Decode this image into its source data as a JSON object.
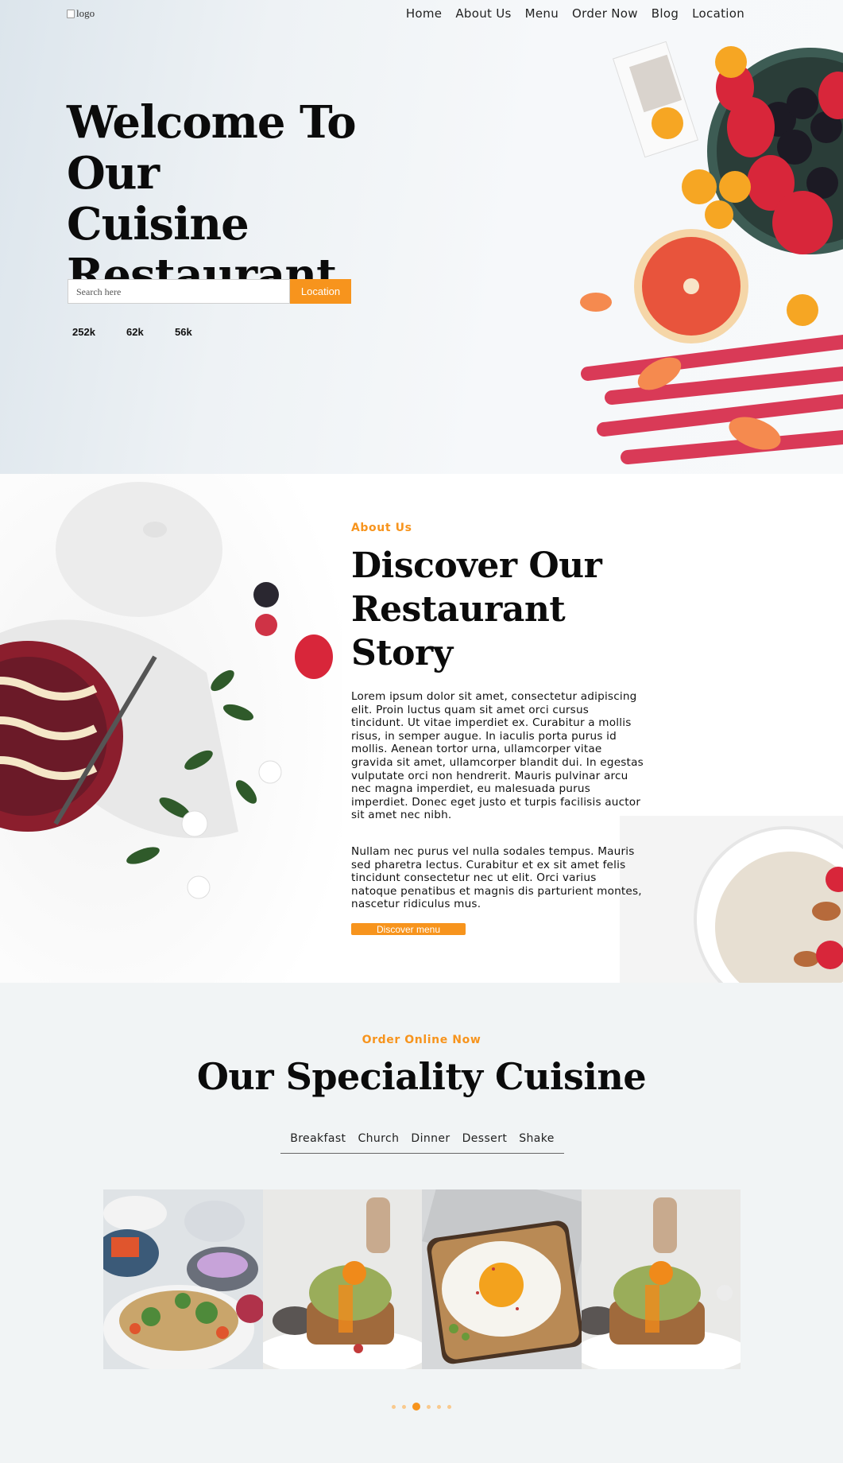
{
  "nav": {
    "logo_alt": "logo",
    "links": [
      "Home",
      "About Us",
      "Menu",
      "Order Now",
      "Blog",
      "Location"
    ]
  },
  "hero": {
    "title_lines": [
      "Welcome To Our",
      "Cuisine",
      "Restaurant"
    ],
    "search_placeholder": "Search here",
    "search_button": "Location",
    "stats": [
      "252k",
      "62k",
      "56k"
    ]
  },
  "about": {
    "kicker": "About Us",
    "title_lines": [
      "Discover Our",
      "Restaurant",
      "Story"
    ],
    "paragraph1": "Lorem ipsum dolor sit amet, consectetur adipiscing elit. Proin luctus quam sit amet orci cursus tincidunt. Ut vitae imperdiet ex. Curabitur a mollis risus, in semper augue. In iaculis porta purus id mollis. Aenean tortor urna, ullamcorper vitae gravida sit amet, ullamcorper blandit dui. In egestas vulputate orci non hendrerit. Mauris pulvinar arcu nec magna imperdiet, eu malesuada purus imperdiet. Donec eget justo et turpis facilisis auctor sit amet nec nibh.",
    "paragraph2": "Nullam nec purus vel nulla sodales tempus. Mauris sed pharetra lectus. Curabitur et ex sit amet felis tincidunt consectetur nec ut elit. Orci varius natoque penatibus et magnis dis parturient montes, nascetur ridiculus mus.",
    "button": "Discover menu"
  },
  "speciality": {
    "kicker": "Order Online Now",
    "title": "Our Speciality Cuisine",
    "tabs": [
      "Breakfast",
      "Church",
      "Dinner",
      "Dessert",
      "Shake"
    ],
    "dots_active_index": 2,
    "dots_count": 6
  },
  "colors": {
    "accent": "#f7941d",
    "hero_bg": "#eef2f5",
    "section_bg": "#f1f4f5"
  }
}
